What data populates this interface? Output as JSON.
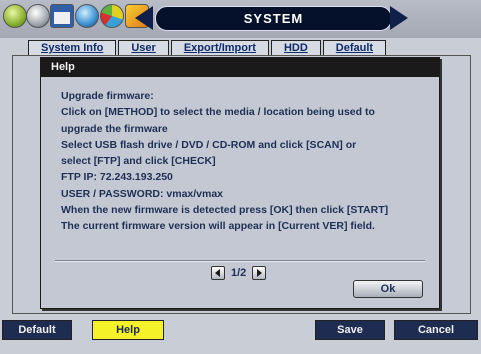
{
  "toolbar": {
    "title": "SYSTEM",
    "icons": [
      "gear-icon",
      "power-icon",
      "calendar-icon",
      "globe-icon",
      "pie-chart-icon",
      "wand-icon"
    ]
  },
  "tabs": [
    {
      "label": "System Info"
    },
    {
      "label": "User"
    },
    {
      "label": "Export/Import"
    },
    {
      "label": "HDD"
    },
    {
      "label": "Default"
    }
  ],
  "help_dialog": {
    "title": "Help",
    "lines": [
      "Upgrade firmware:",
      "Click on [METHOD] to select the media / location being used to",
      " upgrade the firmware",
      "Select USB flash drive / DVD / CD-ROM and click [SCAN] or",
      " select [FTP] and click [CHECK]",
      "FTP IP: 72.243.193.250",
      "USER / PASSWORD: vmax/vmax",
      "When the new firmware is detected press [OK] then click [START]",
      "The current firmware version will appear in [Current VER] field."
    ],
    "page_indicator": "1/2",
    "ok_label": "Ok"
  },
  "bottom_buttons": {
    "default_label": "Default",
    "help_label": "Help",
    "save_label": "Save",
    "cancel_label": "Cancel"
  },
  "colors": {
    "accent_active": "#f6f22a",
    "button_dark": "#1f2c52",
    "text_primary": "#1f2e55"
  }
}
